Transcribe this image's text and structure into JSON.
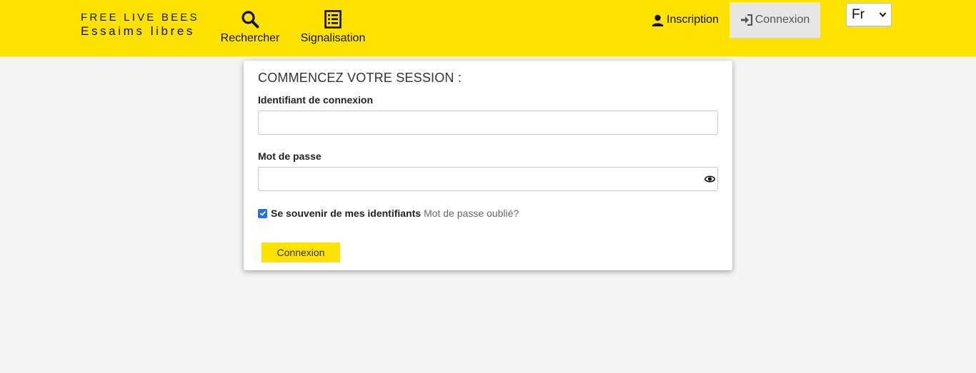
{
  "header": {
    "brand_line1": "FREE LIVE BEES",
    "brand_line2": "Essaims libres",
    "nav": {
      "search_label": "Rechercher",
      "search_icon": "search-icon",
      "report_label": "Signalisation",
      "report_icon": "list-icon"
    },
    "register_label": "Inscription",
    "register_icon": "user-icon",
    "login_label": "Connexion",
    "login_icon": "sign-in-icon",
    "language_selected": "Fr",
    "bar_color": "#ffe200"
  },
  "login_form": {
    "title": "COMMENCEZ VOTRE SESSION :",
    "username_label": "Identifiant de connexion",
    "username_value": "",
    "password_label": "Mot de passe",
    "password_value": "",
    "show_password_icon": "eye-icon",
    "remember_label": "Se souvenir de mes identifiants",
    "remember_checked": true,
    "forgot_label": "Mot de passe oublié?",
    "submit_label": "Connexion"
  }
}
